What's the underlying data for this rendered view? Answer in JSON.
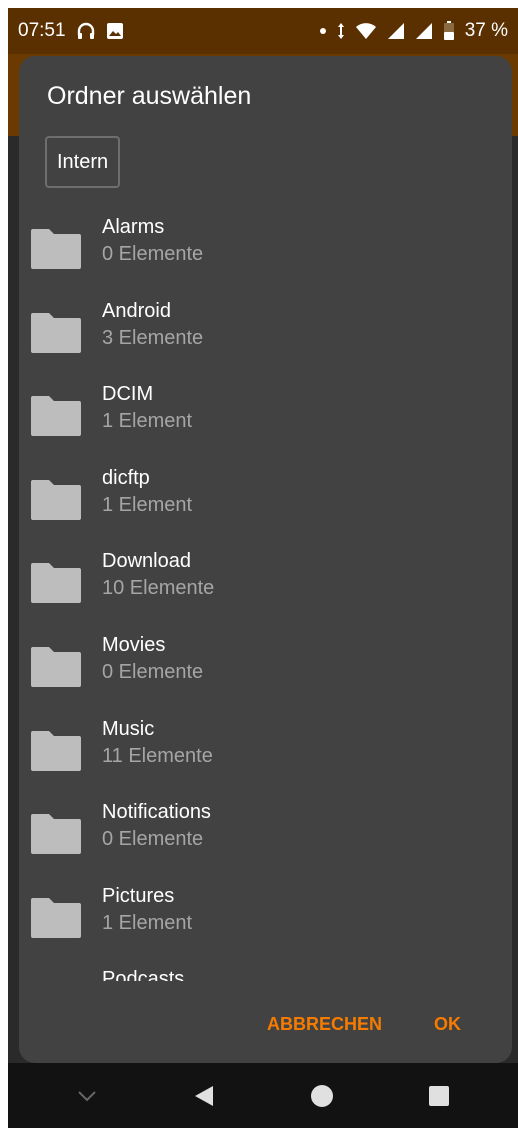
{
  "status_bar": {
    "time": "07:51",
    "battery": "37 %"
  },
  "dialog": {
    "title": "Ordner auswählen",
    "storage_label": "Intern",
    "folders": [
      {
        "name": "Alarms",
        "count": "0 Elemente"
      },
      {
        "name": "Android",
        "count": "3 Elemente"
      },
      {
        "name": "DCIM",
        "count": "1 Element"
      },
      {
        "name": "dicftp",
        "count": "1 Element"
      },
      {
        "name": "Download",
        "count": "10 Elemente"
      },
      {
        "name": "Movies",
        "count": "0 Elemente"
      },
      {
        "name": "Music",
        "count": "11 Elemente"
      },
      {
        "name": "Notifications",
        "count": "0 Elemente"
      },
      {
        "name": "Pictures",
        "count": "1 Element"
      },
      {
        "name": "Podcasts",
        "count": ""
      }
    ],
    "cancel_label": "ABBRECHEN",
    "ok_label": "OK"
  },
  "colors": {
    "accent": "#f57c00",
    "dialog_bg": "#424242",
    "app_bar": "#6b3a00",
    "folder_icon": "#bdbdbd"
  },
  "icons": {
    "status_left": [
      "headphones-icon",
      "image-icon"
    ],
    "status_right": [
      "notification-dot-icon",
      "data-arrows-icon",
      "wifi-icon",
      "signal-icon",
      "signal-icon",
      "battery-icon"
    ],
    "folder": "folder-icon",
    "nav": [
      "chevron-down-icon",
      "back-icon",
      "home-icon",
      "recents-icon"
    ]
  }
}
